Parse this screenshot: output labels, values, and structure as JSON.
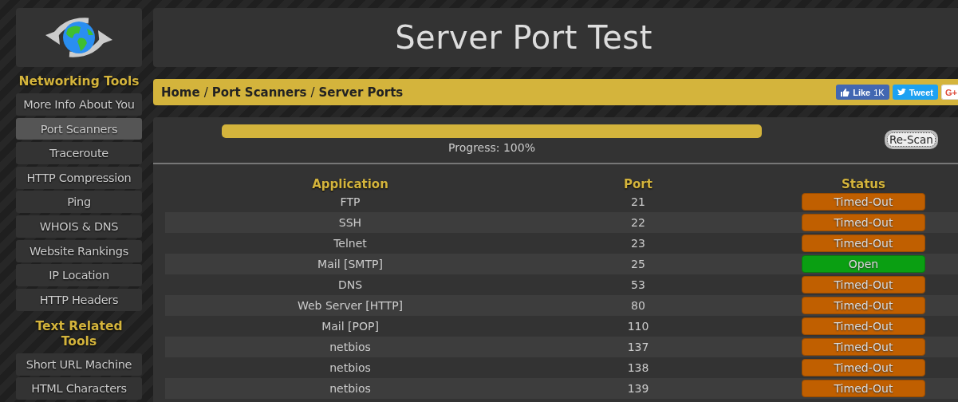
{
  "sidebar": {
    "sections": [
      {
        "heading": "Networking Tools",
        "items": [
          {
            "label": "More Info About You",
            "selected": false
          },
          {
            "label": "Port Scanners",
            "selected": true
          },
          {
            "label": "Traceroute",
            "selected": false
          },
          {
            "label": "HTTP Compression",
            "selected": false
          },
          {
            "label": "Ping",
            "selected": false
          },
          {
            "label": "WHOIS & DNS",
            "selected": false
          },
          {
            "label": "Website Rankings",
            "selected": false
          },
          {
            "label": "IP Location",
            "selected": false
          },
          {
            "label": "HTTP Headers",
            "selected": false
          }
        ]
      },
      {
        "heading": "Text Related Tools",
        "items": [
          {
            "label": "Short URL Machine",
            "selected": false
          },
          {
            "label": "HTML Characters",
            "selected": false
          }
        ]
      }
    ]
  },
  "header": {
    "title": "Server Port Test"
  },
  "breadcrumb": [
    "Home",
    "Port Scanners",
    "Server Ports"
  ],
  "breadcrumb_separator": "/",
  "social": [
    {
      "kind": "like",
      "label": "Like",
      "count": "1K"
    },
    {
      "kind": "tweet",
      "label": "Tweet"
    },
    {
      "kind": "gplus",
      "label": "G+"
    }
  ],
  "progress": {
    "level": 1,
    "label": "Progress: 100%"
  },
  "rescan_button": "Re-Scan",
  "table": {
    "columns": [
      "Application",
      "Port",
      "Status"
    ],
    "rows": [
      {
        "application": "FTP",
        "port": "21",
        "status": {
          "label": "Timed-Out",
          "kind": "timed_out"
        }
      },
      {
        "application": "SSH",
        "port": "22",
        "status": {
          "label": "Timed-Out",
          "kind": "timed_out"
        }
      },
      {
        "application": "Telnet",
        "port": "23",
        "status": {
          "label": "Timed-Out",
          "kind": "timed_out"
        }
      },
      {
        "application": "Mail [SMTP]",
        "port": "25",
        "status": {
          "label": "Open",
          "kind": "open"
        }
      },
      {
        "application": "DNS",
        "port": "53",
        "status": {
          "label": "Timed-Out",
          "kind": "timed_out"
        }
      },
      {
        "application": "Web Server [HTTP]",
        "port": "80",
        "status": {
          "label": "Timed-Out",
          "kind": "timed_out"
        }
      },
      {
        "application": "Mail [POP]",
        "port": "110",
        "status": {
          "label": "Timed-Out",
          "kind": "timed_out"
        }
      },
      {
        "application": "netbios",
        "port": "137",
        "status": {
          "label": "Timed-Out",
          "kind": "timed_out"
        }
      },
      {
        "application": "netbios",
        "port": "138",
        "status": {
          "label": "Timed-Out",
          "kind": "timed_out"
        }
      },
      {
        "application": "netbios",
        "port": "139",
        "status": {
          "label": "Timed-Out",
          "kind": "timed_out"
        }
      }
    ]
  }
}
